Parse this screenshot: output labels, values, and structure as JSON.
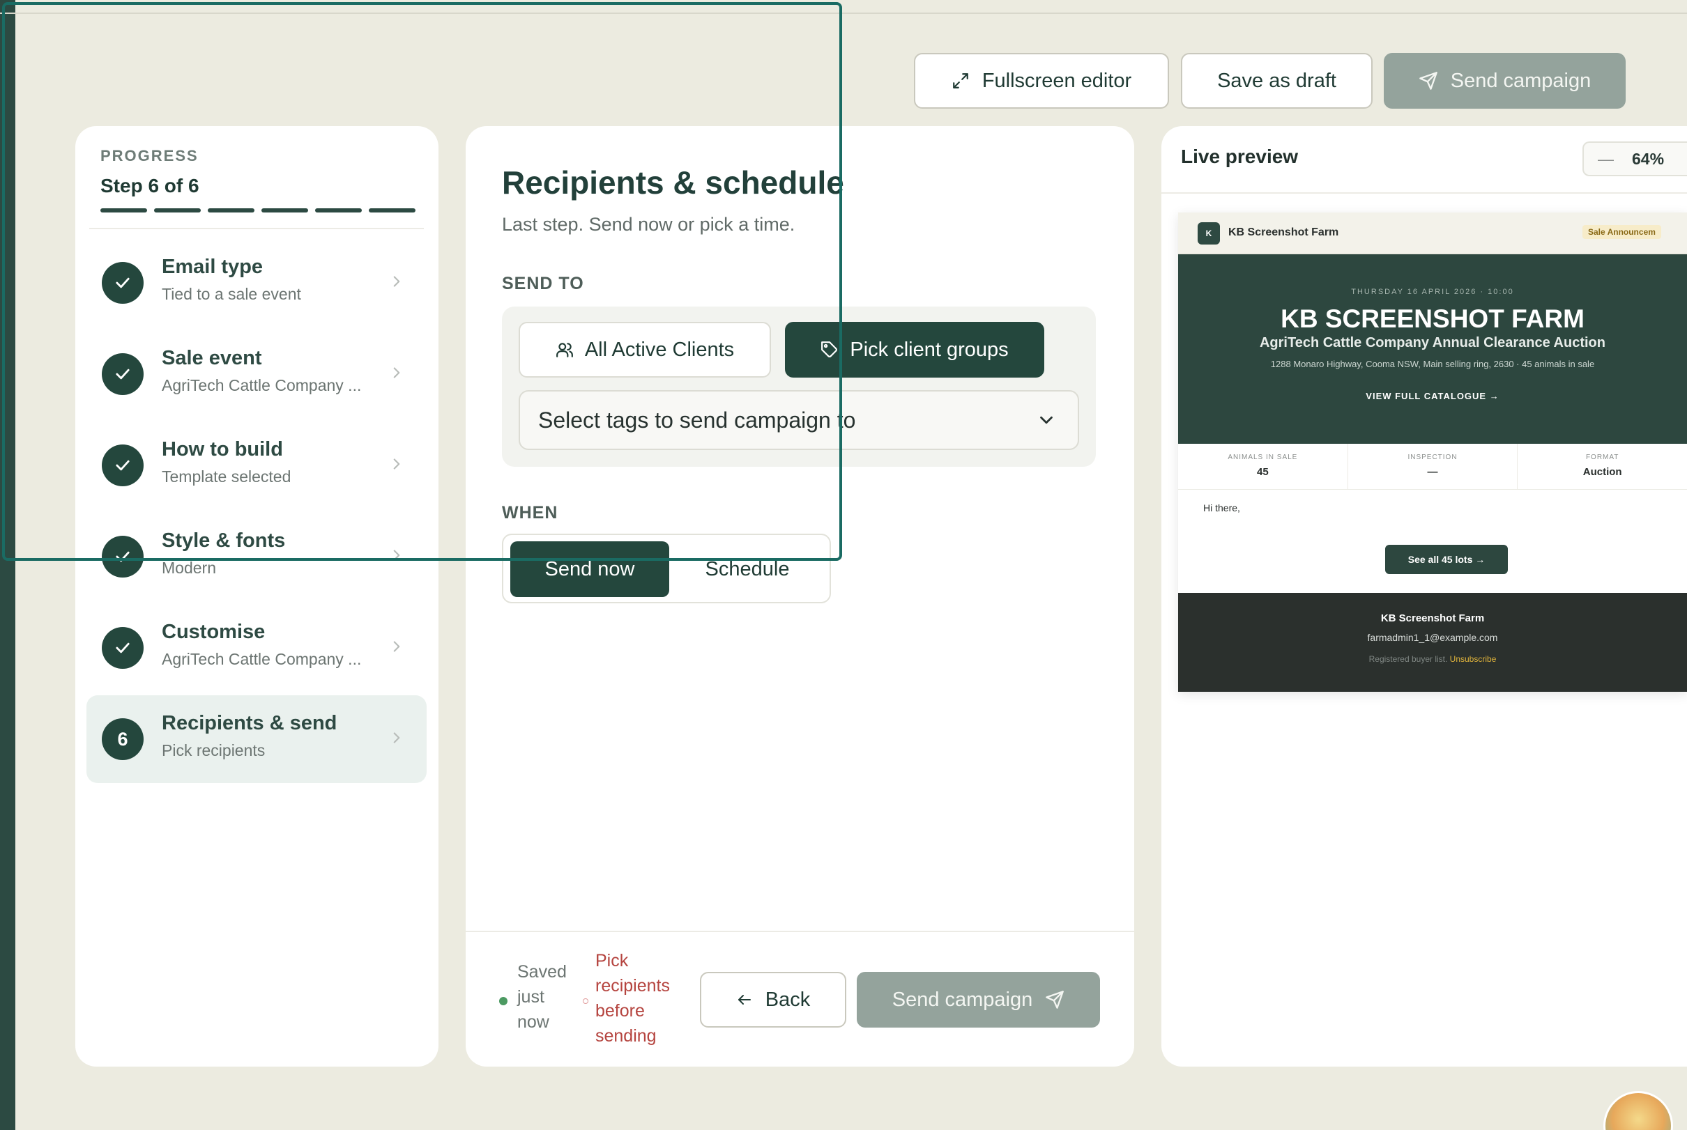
{
  "toolbar": {
    "fullscreen_label": "Fullscreen editor",
    "draft_label": "Save as draft",
    "send_label": "Send campaign"
  },
  "progress": {
    "heading": "PROGRESS",
    "step_text": "Step 6 of 6",
    "current_step": 6,
    "total_steps": 6,
    "steps": [
      {
        "title": "Email type",
        "subtitle": "Tied to a sale event",
        "status": "complete"
      },
      {
        "title": "Sale event",
        "subtitle": "AgriTech Cattle Company ...",
        "status": "complete"
      },
      {
        "title": "How to build",
        "subtitle": "Template selected",
        "status": "complete"
      },
      {
        "title": "Style & fonts",
        "subtitle": "Modern",
        "status": "complete"
      },
      {
        "title": "Customise",
        "subtitle": "AgriTech Cattle Company ...",
        "status": "complete"
      },
      {
        "title": "Recipients & send",
        "subtitle": "Pick recipients",
        "status": "active",
        "number": "6"
      }
    ]
  },
  "main": {
    "title": "Recipients & schedule",
    "subtitle": "Last step. Send now or pick a time.",
    "send_to_label": "SEND TO",
    "all_clients_label": "All Active Clients",
    "pick_groups_label": "Pick client groups",
    "tags_placeholder": "Select tags to send campaign to",
    "when_label": "WHEN",
    "send_now_label": "Send now",
    "schedule_label": "Schedule"
  },
  "footer": {
    "saved_text": "Saved just now",
    "warning_text": "Pick recipients before sending",
    "back_label": "Back",
    "send_label": "Send campaign"
  },
  "preview": {
    "title": "Live preview",
    "zoom": "64%",
    "email": {
      "logo_letter": "K",
      "farm_name": "KB Screenshot Farm",
      "badge": "Sale Announcem",
      "date_line": "THURSDAY 16 APRIL 2026 · 10:00",
      "hero_name": "KB SCREENSHOT FARM",
      "event_name": "AgriTech Cattle Company Annual Clearance Auction",
      "address": "1288 Monaro Highway, Cooma NSW, Main selling ring, 2630 · 45 animals in sale",
      "catalogue_link": "VIEW FULL CATALOGUE →",
      "stats": [
        {
          "label": "ANIMALS IN SALE",
          "value": "45"
        },
        {
          "label": "INSPECTION",
          "value": "—"
        },
        {
          "label": "FORMAT",
          "value": "Auction"
        }
      ],
      "greeting": "Hi there,",
      "lots_button": "See all 45 lots →",
      "footer_name": "KB Screenshot Farm",
      "footer_email": "farmadmin1_1@example.com",
      "footer_registered": "Registered buyer list.",
      "footer_unsubscribe": "Unsubscribe"
    }
  },
  "colors": {
    "background": "#ecebe0",
    "primary_dark": "#24473d",
    "disabled_button": "#94a39c",
    "warning": "#b5443f",
    "saved_dot": "#4c9a62",
    "selection_outline": "#1a6b63"
  }
}
